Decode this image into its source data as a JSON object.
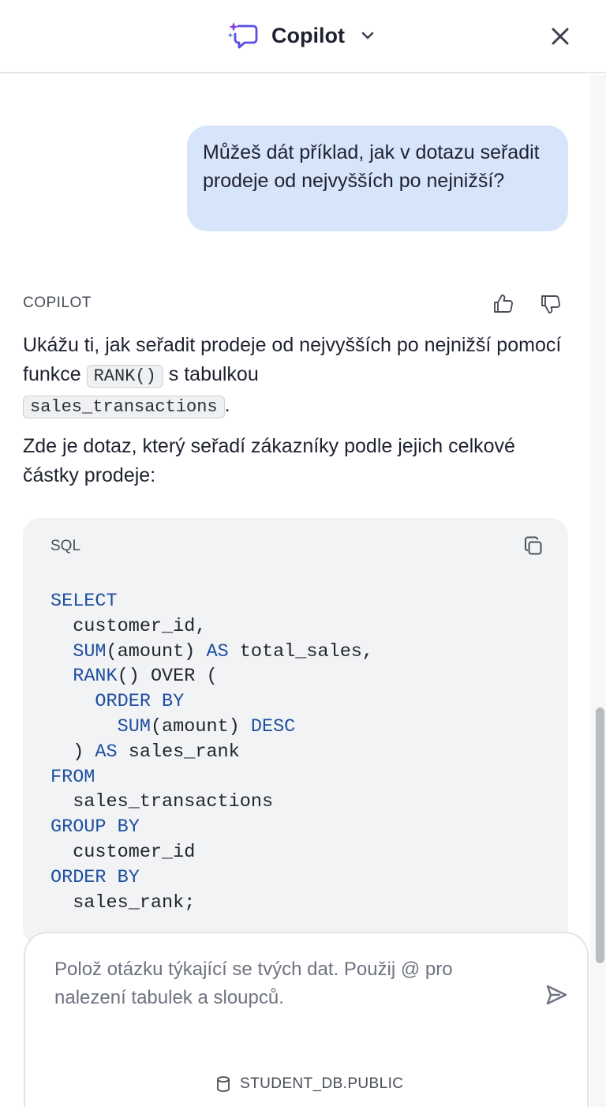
{
  "header": {
    "title": "Copilot",
    "icons": {
      "brand": "copilot-sparkle-chat-icon",
      "dropdown": "chevron-down-icon",
      "close": "close-icon"
    },
    "brand_colors": [
      "#7b3fe4",
      "#3d7bd8"
    ]
  },
  "conversation": {
    "user_message": "Můžeš dát příklad, jak v dotazu seřadit prodeje od nejvyšších po nejnižší?",
    "assistant_label": "COPILOT",
    "feedback_icons": [
      "thumbs-up-icon",
      "thumbs-down-icon"
    ],
    "answer": {
      "p1_before": "Ukážu ti, jak seřadit prodeje od nejvyšších po nejnižší pomocí funkce ",
      "p1_code1": "RANK()",
      "p1_middle": " s tabulkou ",
      "p1_code2": "sales_transactions",
      "p1_after": ".",
      "p2": "Zde je dotaz, který seřadí zákazníky podle jejich celkové částky prodeje:"
    },
    "code_block": {
      "language": "SQL",
      "copy_icon": "copy-icon",
      "lines": [
        [
          {
            "t": "SELECT",
            "k": 1
          }
        ],
        [
          {
            "t": "  customer_id,",
            "k": 0
          }
        ],
        [
          {
            "t": "  ",
            "k": 0
          },
          {
            "t": "SUM",
            "k": 1
          },
          {
            "t": "(amount) ",
            "k": 0
          },
          {
            "t": "AS",
            "k": 1
          },
          {
            "t": " total_sales,",
            "k": 0
          }
        ],
        [
          {
            "t": "  ",
            "k": 0
          },
          {
            "t": "RANK",
            "k": 1
          },
          {
            "t": "() OVER (",
            "k": 0
          }
        ],
        [
          {
            "t": "    ",
            "k": 0
          },
          {
            "t": "ORDER BY",
            "k": 1
          }
        ],
        [
          {
            "t": "      ",
            "k": 0
          },
          {
            "t": "SUM",
            "k": 1
          },
          {
            "t": "(amount) ",
            "k": 0
          },
          {
            "t": "DESC",
            "k": 1
          }
        ],
        [
          {
            "t": "  ) ",
            "k": 0
          },
          {
            "t": "AS",
            "k": 1
          },
          {
            "t": " sales_rank",
            "k": 0
          }
        ],
        [
          {
            "t": "FROM",
            "k": 1
          }
        ],
        [
          {
            "t": "  sales_transactions",
            "k": 0
          }
        ],
        [
          {
            "t": "GROUP BY",
            "k": 1
          }
        ],
        [
          {
            "t": "  customer_id",
            "k": 0
          }
        ],
        [
          {
            "t": "ORDER BY",
            "k": 1
          }
        ],
        [
          {
            "t": "  sales_rank;",
            "k": 0
          }
        ]
      ]
    }
  },
  "composer": {
    "placeholder": "Polož otázku týkající se tvých dat. Použij @ pro nalezení tabulek a sloupců.",
    "send_icon": "send-icon",
    "database_icon": "database-icon",
    "context_label": "STUDENT_DB.PUBLIC"
  }
}
